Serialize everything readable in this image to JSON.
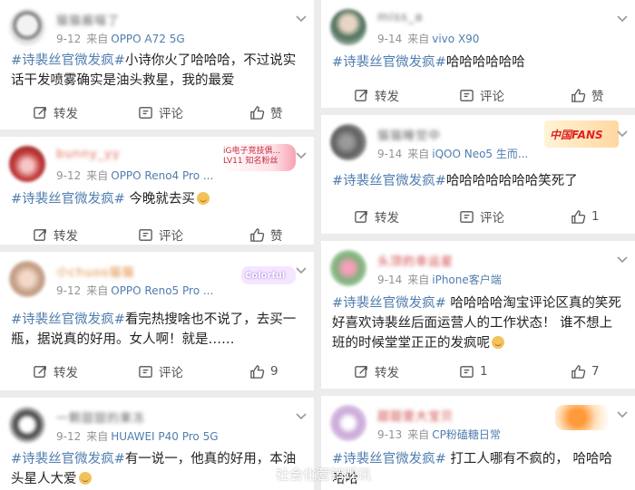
{
  "posts": [
    {
      "user": "猫猫酱喵了",
      "date": "9-12",
      "source_prefix": "来自",
      "device": "OPPO A72 5G",
      "hashtag": "#诗裴丝官微发疯#",
      "text": "小诗你火了哈哈哈，不过说实话干发喷雾确实是油头救星，我的最爱",
      "actions": {
        "repost": "转发",
        "comment": "评论",
        "like": "赞"
      },
      "badge": ""
    },
    {
      "user": "bunny_yy",
      "date": "9-12",
      "source_prefix": "来自",
      "device": "OPPO Reno4 Pro ...",
      "hashtag": "#诗裴丝官微发疯#",
      "text": " 今晚就去买",
      "actions": {
        "repost": "转发",
        "comment": "评论",
        "like": "赞"
      },
      "badge": "iG电子竞技俱... LV11 知名粉丝"
    },
    {
      "user": "小chuoo猫猫",
      "date": "9-12",
      "source_prefix": "来自",
      "device": "OPPO Reno5 Pro ...",
      "hashtag": "#诗裴丝官微发疯#",
      "text": "看完热搜啥也不说了，去买一瓶，据说真的好用。女人啊！就是……",
      "actions": {
        "repost": "转发",
        "comment": "评论",
        "like": "9"
      },
      "badge": "Colorful"
    },
    {
      "user": "一颗甜甜的果冻",
      "date": "9-12",
      "source_prefix": "来自",
      "device": "HUAWEI P40 Pro 5G",
      "hashtag": "#诗裴丝官微发疯#",
      "text": "有一说一，他真的好用，本油头星人大爱",
      "actions": {},
      "badge": ""
    },
    {
      "user": "miss_a",
      "date": "9-14",
      "source_prefix": "来自",
      "device": "vivo X90",
      "hashtag": "#诗裴丝官微发疯#",
      "text": "哈哈哈哈哈哈",
      "actions": {
        "repost": "转发",
        "comment": "评论",
        "like": "赞"
      },
      "badge": ""
    },
    {
      "user": "猫猫睡觉中",
      "date": "9-14",
      "source_prefix": "来自",
      "device": "iQOO Neo5 生而...",
      "hashtag": "#诗裴丝官微发疯#",
      "text": "哈哈哈哈哈哈哈笑死了",
      "actions": {
        "repost": "转发",
        "comment": "评论",
        "like": "1"
      },
      "badge": "中国FANS"
    },
    {
      "user": "头顶的幸运星",
      "date": "9-14",
      "source_prefix": "来自",
      "device": "iPhone客户端",
      "hashtag": "#诗裴丝官微发疯#",
      "text": " 哈哈哈哈淘宝评论区真的笑死 好喜欢诗裴丝后面运营人的工作状态！ 谁不想上班的时候堂堂正正的发疯呢",
      "actions": {
        "repost": "转发",
        "comment": "1",
        "like": "7"
      },
      "badge": ""
    },
    {
      "user": "甜甜是大宝贝",
      "date": "9-13",
      "source_prefix": "来自",
      "device": "CP粉磕糖日常",
      "hashtag": "#诗裴丝官微发疯#",
      "text": " 打工人哪有不疯的， 哈哈哈哈哈",
      "actions": {},
      "badge": ""
    }
  ],
  "watermark": "社会化营销观讯",
  "colors": {
    "accent": "#507daf",
    "bg": "#ececec"
  }
}
